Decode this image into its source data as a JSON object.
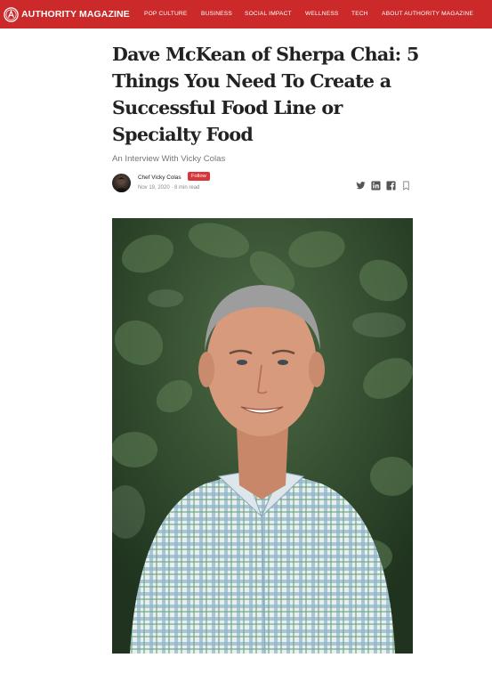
{
  "header": {
    "brand_name": "AUTHORITY MAGAZINE",
    "brand_color": "#cc2a2a",
    "nav": [
      "POP CULTURE",
      "BUSINESS",
      "SOCIAL IMPACT",
      "WELLNESS",
      "TECH",
      "ABOUT AUTHORITY MAGAZINE"
    ]
  },
  "article": {
    "title": "Dave McKean of Sherpa Chai: 5 Things You Need To Create a Successful Food Line or Specialty Food",
    "subtitle": "An Interview With Vicky Colas",
    "author": "Chef Vicky Colas",
    "follow_label": "Follow",
    "meta": "Nov 19, 2020 · 8 min read",
    "share_icons": [
      "twitter-icon",
      "linkedin-icon",
      "facebook-icon",
      "bookmark-icon"
    ]
  }
}
